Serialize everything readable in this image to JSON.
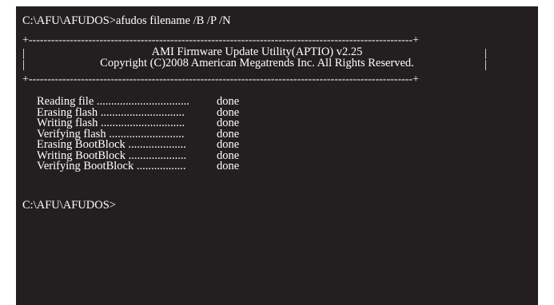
{
  "console": {
    "command_line": "C:\\AFU\\AFUDOS>afudos filename /B /P /N",
    "banner": {
      "border_top": "+-------------------------------------------------------------------------------------------------------+",
      "border_bottom": "+-------------------------------------------------------------------------------------------------------+",
      "side": "|",
      "title": "AMI Firmware Update Utility(APTIO) v2.25",
      "copyright": "Copyright (C)2008 American Megatrends Inc. All Rights Reserved."
    },
    "steps": [
      {
        "label": "Reading file ................................",
        "status": "done"
      },
      {
        "label": "Erasing flash .............................",
        "status": "done"
      },
      {
        "label": "Writing flash .............................",
        "status": "done"
      },
      {
        "label": "Verifying flash ..........................",
        "status": "done"
      },
      {
        "label": "Erasing BootBlock ....................",
        "status": "done"
      },
      {
        "label": "Writing BootBlock ....................",
        "status": "done"
      },
      {
        "label": "Verifying BootBlock .................",
        "status": "done"
      }
    ],
    "prompt": "C:\\AFU\\AFUDOS>"
  }
}
